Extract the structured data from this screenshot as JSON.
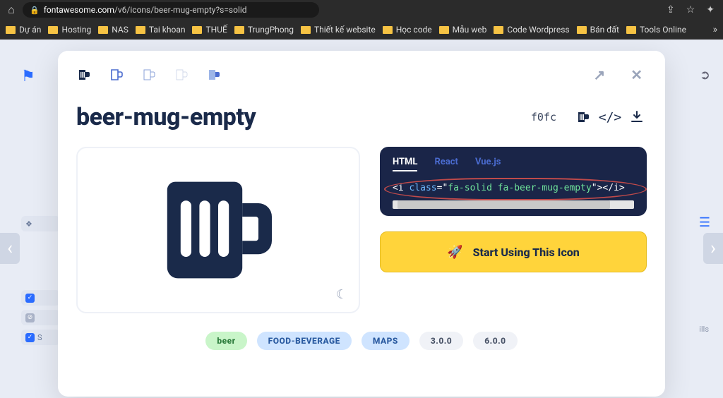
{
  "browser": {
    "domain": "fontawesome.com",
    "path": "/v6/icons/beer-mug-empty?s=solid"
  },
  "bookmarks": [
    "Dự án",
    "Hosting",
    "NAS",
    "Tai khoan",
    "THUẾ",
    "TrungPhong",
    "Thiết kế website",
    "Học code",
    "Mẫu web",
    "Code Wordpress",
    "Bán đất",
    "Tools Online"
  ],
  "icon_name": "beer-mug-empty",
  "unicode": "f0fc",
  "code_tabs": {
    "html": "HTML",
    "react": "React",
    "vue": "Vue.js"
  },
  "code_snippet": {
    "open": "<i ",
    "attr": "class",
    "eq": "=",
    "q": "\"",
    "value": "fa-solid fa-beer-mug-empty",
    "close": "></i>"
  },
  "cta_label": "Start Using This Icon",
  "tags": {
    "beer": "beer",
    "food": "FOOD-BEVERAGE",
    "maps": "MAPS",
    "v3": "3.0.0",
    "v6": "6.0.0"
  },
  "bg_sidebar": {
    "s": "S",
    "ills": "ills"
  }
}
